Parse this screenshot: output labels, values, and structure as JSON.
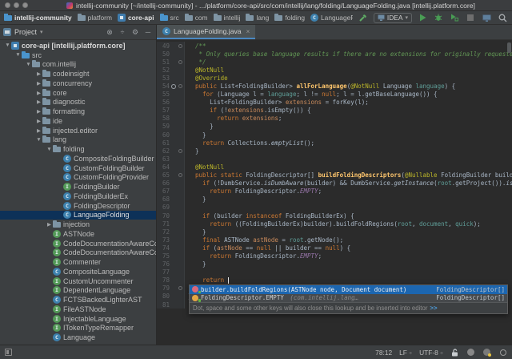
{
  "window": {
    "title": "intellij-community [~/intellij-community] - .../platform/core-api/src/com/intellij/lang/folding/LanguageFolding.java [intellij.platform.core]"
  },
  "colors": {
    "editor_bg": "#2B2B2B",
    "panel_bg": "#3C3F41",
    "gutter_bg": "#313335",
    "tree_selection": "#0D3158",
    "completion_selection": "#1C66B0",
    "keyword": "#CC7832",
    "annotation": "#BBB529",
    "method_decl": "#FFC66D",
    "doc_comment": "#629755",
    "parameter": "#5F9E98",
    "local_var": "#C98A5B",
    "static_field": "#9876AA",
    "default_text": "#A9B7C6",
    "run_green": "#499C54"
  },
  "icon_letters": {
    "class": "C",
    "iface": "I"
  },
  "navbar": {
    "breadcrumbs": [
      {
        "icon": "project",
        "label": "intellij-community",
        "bold": true
      },
      {
        "icon": "folder",
        "label": "platform"
      },
      {
        "icon": "module",
        "label": "core-api",
        "bold": true
      },
      {
        "icon": "src",
        "label": "src"
      },
      {
        "icon": "package",
        "label": "com"
      },
      {
        "icon": "package",
        "label": "intellij"
      },
      {
        "icon": "package",
        "label": "lang"
      },
      {
        "icon": "package",
        "label": "folding"
      },
      {
        "icon": "class",
        "label": "LanguageFolding"
      }
    ],
    "run_config": "IDEA"
  },
  "project_panel": {
    "title": "Project",
    "header_icons": [
      "locate-icon",
      "collapse-all-icon",
      "gear-icon",
      "hide-icon"
    ],
    "tree": [
      {
        "level": 0,
        "arrow": "v",
        "icon": "module",
        "label": "core-api [intellij.platform.core]",
        "bold": true
      },
      {
        "level": 1,
        "arrow": "v",
        "icon": "src",
        "label": "src"
      },
      {
        "level": 2,
        "arrow": "v",
        "icon": "package",
        "label": "com.intellij"
      },
      {
        "level": 3,
        "arrow": ">",
        "icon": "package",
        "label": "codeinsight"
      },
      {
        "level": 3,
        "arrow": ">",
        "icon": "package",
        "label": "concurrency"
      },
      {
        "level": 3,
        "arrow": ">",
        "icon": "package",
        "label": "core"
      },
      {
        "level": 3,
        "arrow": ">",
        "icon": "package",
        "label": "diagnostic"
      },
      {
        "level": 3,
        "arrow": ">",
        "icon": "package",
        "label": "formatting"
      },
      {
        "level": 3,
        "arrow": ">",
        "icon": "package",
        "label": "ide"
      },
      {
        "level": 3,
        "arrow": ">",
        "icon": "package",
        "label": "injected.editor"
      },
      {
        "level": 3,
        "arrow": "v",
        "icon": "package",
        "label": "lang"
      },
      {
        "level": 4,
        "arrow": "v",
        "icon": "package",
        "label": "folding"
      },
      {
        "level": 5,
        "arrow": "",
        "icon": "class",
        "label": "CompositeFoldingBuilder"
      },
      {
        "level": 5,
        "arrow": "",
        "icon": "class",
        "label": "CustomFoldingBuilder"
      },
      {
        "level": 5,
        "arrow": "",
        "icon": "class",
        "label": "CustomFoldingProvider"
      },
      {
        "level": 5,
        "arrow": "",
        "icon": "iface",
        "label": "FoldingBuilder"
      },
      {
        "level": 5,
        "arrow": "",
        "icon": "class",
        "label": "FoldingBuilderEx"
      },
      {
        "level": 5,
        "arrow": "",
        "icon": "class",
        "label": "FoldingDescriptor"
      },
      {
        "level": 5,
        "arrow": "",
        "icon": "class",
        "label": "LanguageFolding",
        "selected": true
      },
      {
        "level": 4,
        "arrow": ">",
        "icon": "package",
        "label": "injection"
      },
      {
        "level": 4,
        "arrow": "",
        "icon": "iface",
        "label": "ASTNode"
      },
      {
        "level": 4,
        "arrow": "",
        "icon": "iface",
        "label": "CodeDocumentationAwareCo"
      },
      {
        "level": 4,
        "arrow": "",
        "icon": "iface",
        "label": "CodeDocumentationAwareCo"
      },
      {
        "level": 4,
        "arrow": "",
        "icon": "iface",
        "label": "Commenter"
      },
      {
        "level": 4,
        "arrow": "",
        "icon": "class",
        "label": "CompositeLanguage"
      },
      {
        "level": 4,
        "arrow": "",
        "icon": "iface",
        "label": "CustomUncommenter"
      },
      {
        "level": 4,
        "arrow": "",
        "icon": "iface",
        "label": "DependentLanguage"
      },
      {
        "level": 4,
        "arrow": "",
        "icon": "class",
        "label": "FCTSBackedLighterAST"
      },
      {
        "level": 4,
        "arrow": "",
        "icon": "iface",
        "label": "FileASTNode"
      },
      {
        "level": 4,
        "arrow": "",
        "icon": "iface",
        "label": "InjectableLanguage"
      },
      {
        "level": 4,
        "arrow": "",
        "icon": "iface",
        "label": "ITokenTypeRemapper"
      },
      {
        "level": 4,
        "arrow": "",
        "icon": "class",
        "label": "Language"
      }
    ]
  },
  "editor": {
    "tab": {
      "label": "LanguageFolding.java",
      "close": "×"
    },
    "lines": [
      {
        "n": 49,
        "fold": "o",
        "t": [
          [
            "c",
            "  /**"
          ]
        ]
      },
      {
        "n": 50,
        "t": [
          [
            "c",
            "   * Only queries base language results if there are no extensions for originally requested"
          ]
        ]
      },
      {
        "n": 51,
        "fold": "o",
        "t": [
          [
            "c",
            "   */"
          ]
        ]
      },
      {
        "n": 52,
        "t": [
          [
            "a",
            "  @NotNull"
          ]
        ]
      },
      {
        "n": 53,
        "t": [
          [
            "a",
            "  @Override"
          ]
        ]
      },
      {
        "n": 54,
        "mark": "override",
        "fold": "o",
        "t": [
          [
            "k",
            "  public "
          ],
          [
            "d",
            "List<FoldingBuilder> "
          ],
          [
            "m",
            "allForLanguage"
          ],
          [
            "d",
            "("
          ],
          [
            "a",
            "@NotNull"
          ],
          [
            "d",
            " Language "
          ],
          [
            "p",
            "language"
          ],
          [
            "d",
            ") {"
          ]
        ]
      },
      {
        "n": 55,
        "t": [
          [
            "d",
            "    "
          ],
          [
            "k",
            "for"
          ],
          [
            "d",
            " (Language l = "
          ],
          [
            "p",
            "language"
          ],
          [
            "d",
            "; l != "
          ],
          [
            "k",
            "null"
          ],
          [
            "d",
            "; l = l.getBaseLanguage()) {"
          ]
        ]
      },
      {
        "n": 56,
        "t": [
          [
            "d",
            "      List<FoldingBuilder> "
          ],
          [
            "v",
            "extensions"
          ],
          [
            "d",
            " = forKey(l);"
          ]
        ]
      },
      {
        "n": 57,
        "t": [
          [
            "d",
            "      "
          ],
          [
            "k",
            "if"
          ],
          [
            "d",
            " (!"
          ],
          [
            "v",
            "extensions"
          ],
          [
            "d",
            ".isEmpty()) {"
          ]
        ]
      },
      {
        "n": 58,
        "t": [
          [
            "d",
            "        "
          ],
          [
            "k",
            "return"
          ],
          [
            "d",
            " "
          ],
          [
            "v",
            "extensions"
          ],
          [
            "d",
            ";"
          ]
        ]
      },
      {
        "n": 59,
        "t": [
          [
            "d",
            "      }"
          ]
        ]
      },
      {
        "n": 60,
        "t": [
          [
            "d",
            "    }"
          ]
        ]
      },
      {
        "n": 61,
        "t": [
          [
            "d",
            "    "
          ],
          [
            "k",
            "return"
          ],
          [
            "d",
            " Collections."
          ],
          [
            "i",
            "emptyList"
          ],
          [
            "d",
            "();"
          ]
        ]
      },
      {
        "n": 62,
        "fold": "o",
        "t": [
          [
            "d",
            "  }"
          ]
        ]
      },
      {
        "n": 63,
        "t": []
      },
      {
        "n": 64,
        "t": [
          [
            "a",
            "  @NotNull"
          ]
        ]
      },
      {
        "n": 65,
        "fold": "o",
        "t": [
          [
            "k",
            "  public static "
          ],
          [
            "d",
            "FoldingDescriptor[] "
          ],
          [
            "m",
            "buildFoldingDescriptors"
          ],
          [
            "d",
            "("
          ],
          [
            "a",
            "@Nullable"
          ],
          [
            "d",
            " FoldingBuilder builder,"
          ]
        ]
      },
      {
        "n": 66,
        "t": [
          [
            "d",
            "    "
          ],
          [
            "k",
            "if"
          ],
          [
            "d",
            " (!DumbService."
          ],
          [
            "i",
            "isDumbAware"
          ],
          [
            "d",
            "(builder) && DumbService."
          ],
          [
            "i",
            "getInstance"
          ],
          [
            "d",
            "("
          ],
          [
            "p",
            "root"
          ],
          [
            "d",
            ".getProject())."
          ],
          [
            "i",
            "isDumb"
          ]
        ]
      },
      {
        "n": 67,
        "t": [
          [
            "d",
            "      "
          ],
          [
            "k",
            "return"
          ],
          [
            "d",
            " FoldingDescriptor."
          ],
          [
            "s",
            "EMPTY"
          ],
          [
            "d",
            ";"
          ]
        ]
      },
      {
        "n": 68,
        "t": [
          [
            "d",
            "    }"
          ]
        ]
      },
      {
        "n": 69,
        "t": []
      },
      {
        "n": 70,
        "t": [
          [
            "d",
            "    "
          ],
          [
            "k",
            "if"
          ],
          [
            "d",
            " (builder "
          ],
          [
            "k",
            "instanceof"
          ],
          [
            "d",
            " FoldingBuilderEx) {"
          ]
        ]
      },
      {
        "n": 71,
        "t": [
          [
            "d",
            "      "
          ],
          [
            "k",
            "return"
          ],
          [
            "d",
            " ((FoldingBuilderEx)builder).buildFoldRegions("
          ],
          [
            "p",
            "root"
          ],
          [
            "d",
            ", "
          ],
          [
            "p",
            "document"
          ],
          [
            "d",
            ", "
          ],
          [
            "p",
            "quick"
          ],
          [
            "d",
            ");"
          ]
        ]
      },
      {
        "n": 72,
        "t": [
          [
            "d",
            "    }"
          ]
        ]
      },
      {
        "n": 73,
        "t": [
          [
            "d",
            "    "
          ],
          [
            "k",
            "final"
          ],
          [
            "d",
            " ASTNode "
          ],
          [
            "v",
            "astNode"
          ],
          [
            "d",
            " = "
          ],
          [
            "p",
            "root"
          ],
          [
            "d",
            ".getNode();"
          ]
        ]
      },
      {
        "n": 74,
        "t": [
          [
            "d",
            "    "
          ],
          [
            "k",
            "if"
          ],
          [
            "d",
            " ("
          ],
          [
            "v",
            "astNode"
          ],
          [
            "d",
            " == "
          ],
          [
            "k",
            "null"
          ],
          [
            "d",
            " || builder == "
          ],
          [
            "k",
            "null"
          ],
          [
            "d",
            ") {"
          ]
        ]
      },
      {
        "n": 75,
        "t": [
          [
            "d",
            "      "
          ],
          [
            "k",
            "return"
          ],
          [
            "d",
            " FoldingDescriptor."
          ],
          [
            "s",
            "EMPTY"
          ],
          [
            "d",
            ";"
          ]
        ]
      },
      {
        "n": 76,
        "t": [
          [
            "d",
            "    }"
          ]
        ]
      },
      {
        "n": 77,
        "t": []
      },
      {
        "n": 78,
        "caret": true,
        "t": [
          [
            "d",
            "    "
          ],
          [
            "k",
            "return"
          ],
          [
            "d",
            " "
          ]
        ]
      },
      {
        "n": 79,
        "fold": "o",
        "t": [
          [
            "d",
            "  }"
          ]
        ]
      },
      {
        "n": 80,
        "t": [
          [
            "d",
            "}"
          ]
        ]
      },
      {
        "n": 81,
        "t": []
      }
    ]
  },
  "completion": {
    "items": [
      {
        "kind": "method",
        "text": "builder.buildFoldRegions(ASTNode node, Document document)",
        "tail": "",
        "type": "FoldingDescriptor[]",
        "selected": true
      },
      {
        "kind": "field",
        "text": "FoldingDescriptor.EMPTY ",
        "tail": "(com.intellij.lang…",
        "type": "FoldingDescriptor[]"
      }
    ],
    "hint": "Dot, space and some other keys will also close this lookup and be inserted into editor",
    "hint_link": ">>"
  },
  "status_bar": {
    "position": "78:12",
    "line_ending": "LF",
    "encoding": "UTF-8",
    "widget_sep": "÷"
  }
}
